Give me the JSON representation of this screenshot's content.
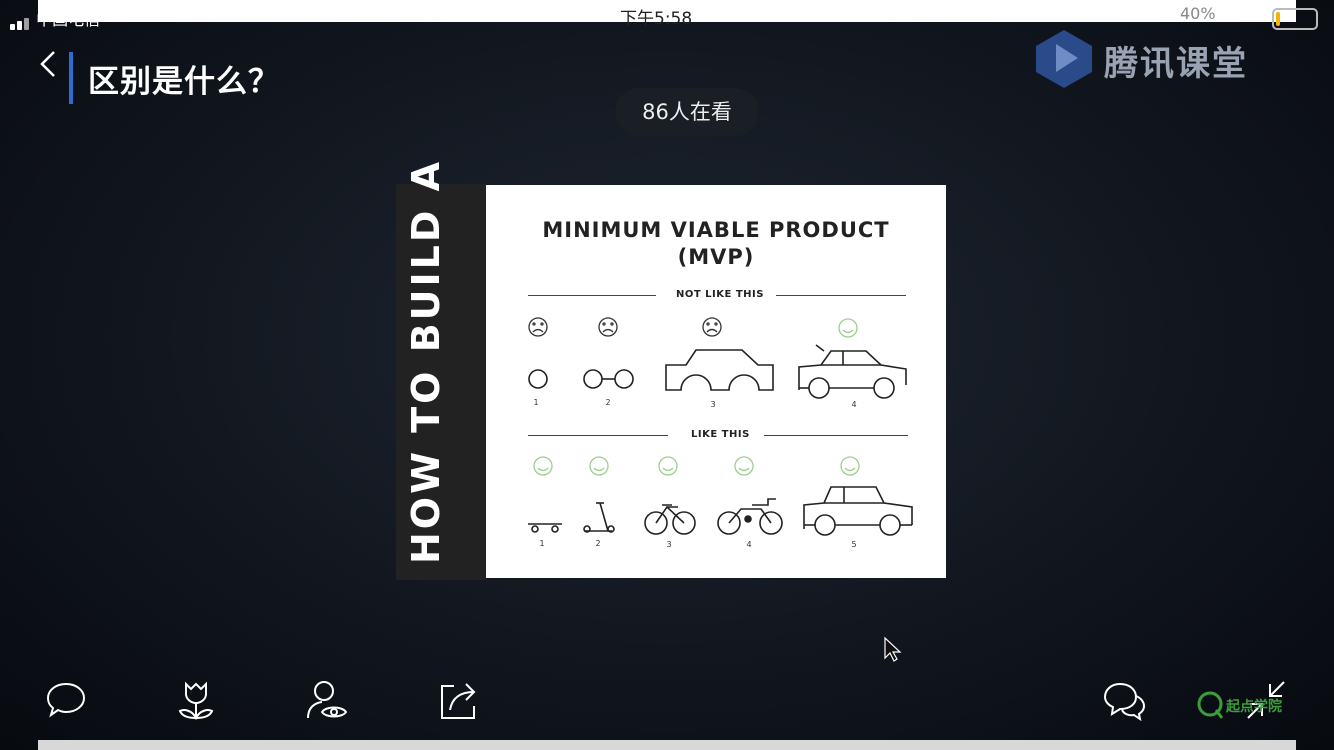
{
  "status_bar": {
    "carrier": "中国电信",
    "time": "下午5:58",
    "battery": "40%",
    "battery_level": 0.1
  },
  "header": {
    "title": "区别是什么？"
  },
  "brand": {
    "name": "腾讯课堂"
  },
  "viewers": "86人在看",
  "slide": {
    "spine_text": "HOW TO BUILD A",
    "title_line1": "MINIMUM VIABLE PRODUCT",
    "title_line2": "(MVP)",
    "section_not": "NOT LIKE THIS",
    "section_like": "LIKE THIS",
    "not_like_numbers": [
      "1",
      "2",
      "3",
      "4"
    ],
    "like_numbers": [
      "1",
      "2",
      "3",
      "4",
      "5"
    ]
  },
  "watermark": "起点学院",
  "icons": [
    "back-icon",
    "comment-icon",
    "flower-icon",
    "watch-icon",
    "share-icon",
    "chat-icon",
    "collapse-icon"
  ]
}
